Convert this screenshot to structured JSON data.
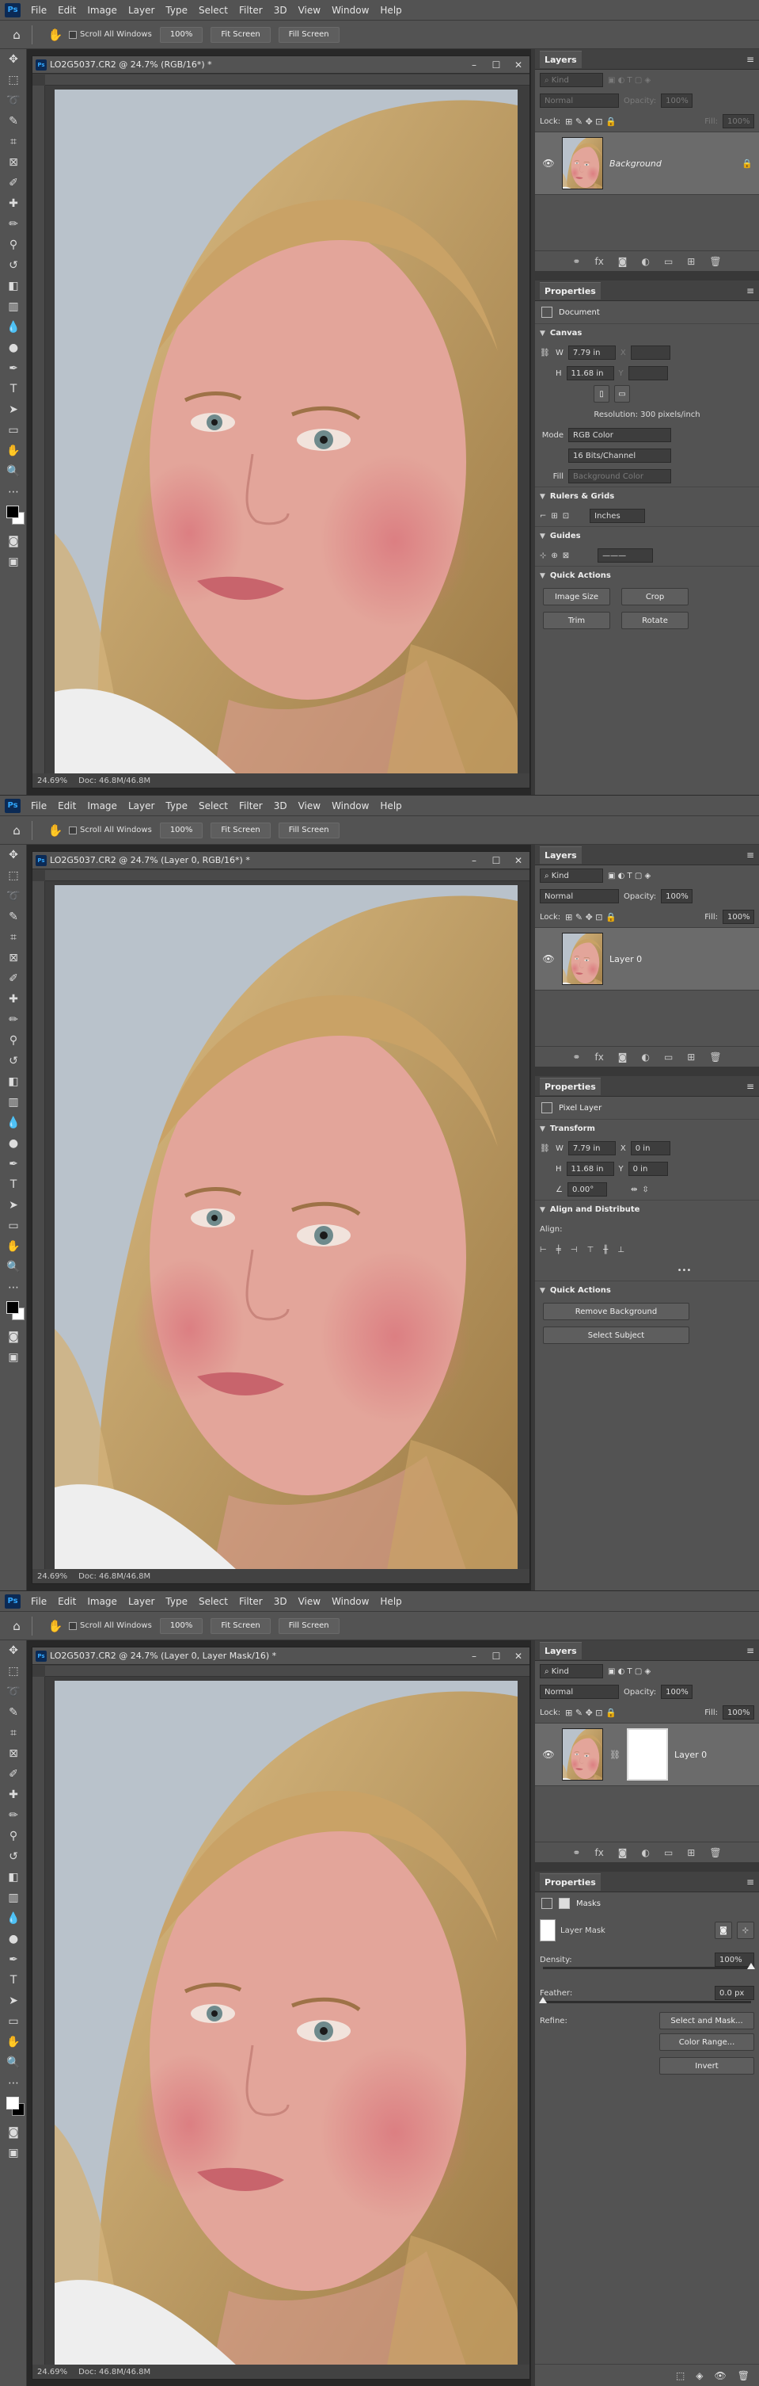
{
  "menu": [
    "File",
    "Edit",
    "Image",
    "Layer",
    "Type",
    "Select",
    "Filter",
    "3D",
    "View",
    "Window",
    "Help"
  ],
  "ps_logo": "Ps",
  "options": {
    "scroll_all": "Scroll All Windows",
    "zoom_100": "100%",
    "fit_screen": "Fit Screen",
    "fill_screen": "Fill Screen"
  },
  "screens": [
    {
      "doc_title": "LO2G5037.CR2 @ 24.7% (RGB/16*) *",
      "status_zoom": "24.69%",
      "status_doc": "Doc: 46.8M/46.8M",
      "layers": {
        "tab": "Layers",
        "kind": "Kind",
        "blend": "Normal",
        "opacity_label": "Opacity:",
        "opacity": "100%",
        "lock_label": "Lock:",
        "fill_label": "Fill:",
        "fill": "100%",
        "layer_name": "Background"
      },
      "properties": {
        "tab": "Properties",
        "type": "Document",
        "canvas": "Canvas",
        "w_label": "W",
        "w": "7.79 in",
        "h_label": "H",
        "h": "11.68 in",
        "x_label": "X",
        "y_label": "Y",
        "resolution": "Resolution: 300 pixels/inch",
        "mode_label": "Mode",
        "mode": "RGB Color",
        "bits": "16 Bits/Channel",
        "fill_label": "Fill",
        "fill": "Background Color",
        "rulers": "Rulers & Grids",
        "units": "Inches",
        "guides": "Guides",
        "quick_actions": "Quick Actions",
        "image_size": "Image Size",
        "crop": "Crop",
        "trim": "Trim",
        "rotate": "Rotate"
      }
    },
    {
      "doc_title": "LO2G5037.CR2 @ 24.7% (Layer 0, RGB/16*) *",
      "status_zoom": "24.69%",
      "status_doc": "Doc: 46.8M/46.8M",
      "layers": {
        "tab": "Layers",
        "kind": "Kind",
        "blend": "Normal",
        "opacity_label": "Opacity:",
        "opacity": "100%",
        "lock_label": "Lock:",
        "fill_label": "Fill:",
        "fill": "100%",
        "layer_name": "Layer 0"
      },
      "properties": {
        "tab": "Properties",
        "type": "Pixel Layer",
        "transform": "Transform",
        "w_label": "W",
        "w": "7.79 in",
        "h_label": "H",
        "h": "11.68 in",
        "x_label": "X",
        "x": "0 in",
        "y_label": "Y",
        "y": "0 in",
        "angle": "0.00°",
        "align": "Align and Distribute",
        "align_label": "Align:",
        "more": "•••",
        "quick_actions": "Quick Actions",
        "remove_bg": "Remove Background",
        "select_subject": "Select Subject"
      }
    },
    {
      "doc_title": "LO2G5037.CR2 @ 24.7% (Layer 0, Layer Mask/16) *",
      "status_zoom": "24.69%",
      "status_doc": "Doc: 46.8M/46.8M",
      "layers": {
        "tab": "Layers",
        "kind": "Kind",
        "blend": "Normal",
        "opacity_label": "Opacity:",
        "opacity": "100%",
        "lock_label": "Lock:",
        "fill_label": "Fill:",
        "fill": "100%",
        "layer_name": "Layer 0"
      },
      "properties": {
        "tab": "Properties",
        "type": "Masks",
        "mask_name": "Layer Mask",
        "density_label": "Density:",
        "density": "100%",
        "feather_label": "Feather:",
        "feather": "0.0 px",
        "refine_label": "Refine:",
        "select_mask": "Select and Mask...",
        "color_range": "Color Range...",
        "invert": "Invert"
      }
    }
  ],
  "sliders": {
    "density": 1.0,
    "feather": 0.0
  },
  "colors": {
    "panel": "#535353",
    "dark": "#282828",
    "skin": "#e3a59a",
    "hair": "#c9a266",
    "background": "#b9c2cb"
  },
  "tool_icons": [
    "move-icon",
    "marquee-icon",
    "lasso-icon",
    "quick-select-icon",
    "crop-icon",
    "frame-icon",
    "eyedropper-icon",
    "spot-heal-icon",
    "brush-icon",
    "clone-stamp-icon",
    "history-brush-icon",
    "eraser-icon",
    "gradient-icon",
    "blur-icon",
    "dodge-icon",
    "pen-icon",
    "type-icon",
    "path-select-icon",
    "rectangle-icon",
    "hand-icon",
    "zoom-icon"
  ]
}
